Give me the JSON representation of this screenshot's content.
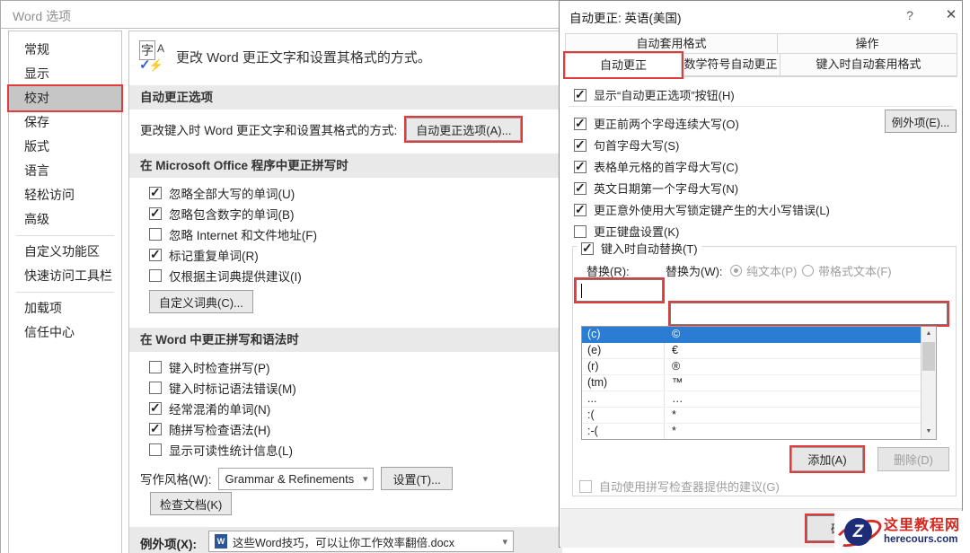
{
  "colors": {
    "annotation_red": "#e23b3b",
    "selection_blue": "#2b7cd3",
    "sidebar_selected_gray": "#c6c6c6",
    "section_header_bg": "#e9e9e9",
    "watermark_red": "#d42a22",
    "watermark_navy": "#1d2d78"
  },
  "icons": {
    "help": "?",
    "close": "✕",
    "dropdown": "▾",
    "scroll_up": "▲",
    "scroll_down": "▼",
    "doc_letter": "W",
    "autocorrect_icon": {
      "char": "字",
      "letter": "A",
      "check": "✓",
      "bolt": "⚡"
    }
  },
  "word_options": {
    "title": "Word 选项",
    "sidebar": {
      "items": [
        {
          "label": "常规"
        },
        {
          "label": "显示"
        },
        {
          "label": "校对",
          "selected": true
        },
        {
          "label": "保存"
        },
        {
          "label": "版式"
        },
        {
          "label": "语言"
        },
        {
          "label": "轻松访问"
        },
        {
          "label": "高级"
        },
        {
          "label": "自定义功能区"
        },
        {
          "label": "快速访问工具栏"
        },
        {
          "label": "加载项"
        },
        {
          "label": "信任中心"
        }
      ]
    },
    "main": {
      "intro": "更改 Word 更正文字和设置其格式的方式。",
      "autocorrect_options": {
        "header": "自动更正选项",
        "row_label": "更改键入时 Word 更正文字和设置其格式的方式:",
        "button_label": "自动更正选项(A)..."
      },
      "office_spelling": {
        "header": "在 Microsoft Office 程序中更正拼写时",
        "checkboxes": [
          {
            "label": "忽略全部大写的单词(U)",
            "checked": true
          },
          {
            "label": "忽略包含数字的单词(B)",
            "checked": true
          },
          {
            "label": "忽略 Internet 和文件地址(F)",
            "checked": false
          },
          {
            "label": "标记重复单词(R)",
            "checked": true
          },
          {
            "label": "仅根据主词典提供建议(I)",
            "checked": false
          }
        ],
        "custom_dict_button": "自定义词典(C)..."
      },
      "word_grammar": {
        "header": "在 Word 中更正拼写和语法时",
        "checkboxes": [
          {
            "label": "键入时检查拼写(P)",
            "checked": false
          },
          {
            "label": "键入时标记语法错误(M)",
            "checked": false
          },
          {
            "label": "经常混淆的单词(N)",
            "checked": true
          },
          {
            "label": "随拼写检查语法(H)",
            "checked": true
          },
          {
            "label": "显示可读性统计信息(L)",
            "checked": false
          }
        ],
        "writing_style_label": "写作风格(W):",
        "writing_style_value": "Grammar & Refinements",
        "settings_button": "设置(T)...",
        "check_document_button": "检查文档(K)"
      },
      "exceptions": {
        "label": "例外项(X):",
        "value": "这些Word技巧，可以让你工作效率翻倍.docx"
      }
    }
  },
  "autocorrect_dialog": {
    "title": "自动更正: 英语(美国)",
    "tabs_row1": [
      {
        "label": "自动套用格式"
      },
      {
        "label": "操作"
      }
    ],
    "tabs_row2": [
      {
        "label": "自动更正",
        "active": true
      },
      {
        "label": "数学符号自动更正"
      },
      {
        "label": "键入时自动套用格式"
      }
    ],
    "checkboxes": [
      {
        "label": "显示“自动更正选项”按钮(H)",
        "checked": true
      },
      {
        "label": "更正前两个字母连续大写(O)",
        "checked": true
      },
      {
        "label": "句首字母大写(S)",
        "checked": true
      },
      {
        "label": "表格单元格的首字母大写(C)",
        "checked": true
      },
      {
        "label": "英文日期第一个字母大写(N)",
        "checked": true
      },
      {
        "label": "更正意外使用大写锁定键产生的大小写错误(L)",
        "checked": true
      },
      {
        "label": "更正键盘设置(K)",
        "checked": false
      }
    ],
    "exceptions_button": "例外项(E)...",
    "replace_group": {
      "caption": {
        "label": "键入时自动替换(T)",
        "checked": true
      },
      "replace_label": "替换(R):",
      "with_label": "替换为(W):",
      "radio_plain": {
        "label": "纯文本(P)",
        "selected": true
      },
      "radio_formatted": {
        "label": "带格式文本(F)",
        "selected": false
      },
      "replace_input_value": "",
      "with_input_value": "",
      "table_rows": [
        {
          "from": "(c)",
          "to": "©",
          "selected": true
        },
        {
          "from": "(e)",
          "to": "€"
        },
        {
          "from": "(r)",
          "to": "®"
        },
        {
          "from": "(tm)",
          "to": "™"
        },
        {
          "from": "...",
          "to": "…"
        },
        {
          "from": ":(",
          "to": "*"
        },
        {
          "from": ":-(",
          "to": "*"
        }
      ],
      "add_button": "添加(A)",
      "delete_button": "删除(D)",
      "suggestion_checkbox": {
        "label": "自动使用拼写检查器提供的建议(G)",
        "checked": false
      }
    },
    "footer": {
      "ok_button": "确定"
    }
  },
  "watermark": {
    "logo_letter": "Z",
    "site_name": "这里教程网",
    "site_url": "herecours.com"
  }
}
